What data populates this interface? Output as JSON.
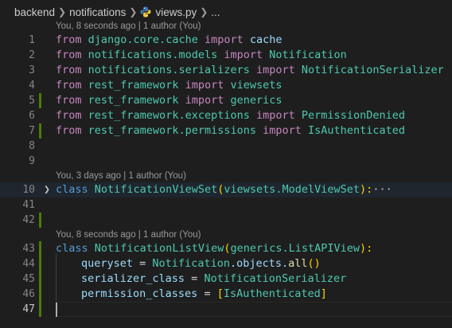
{
  "breadcrumb": {
    "items": [
      "backend",
      "notifications",
      "views.py",
      "..."
    ],
    "file_icon": "python-icon"
  },
  "codelens": {
    "header1": "You, 8 seconds ago | 1 author (You)",
    "header2": "You, 3 days ago | 1 author (You)",
    "header3": "You, 8 seconds ago | 1 author (You)"
  },
  "lines": {
    "l1": {
      "num": "1",
      "from": "from",
      "module": "django.core.cache",
      "import": "import",
      "name": "cache"
    },
    "l2": {
      "num": "2",
      "from": "from",
      "module": "notifications.models",
      "import": "import",
      "name": "Notification"
    },
    "l3": {
      "num": "3",
      "from": "from",
      "module": "notifications.serializers",
      "import": "import",
      "name": "NotificationSerializer"
    },
    "l4": {
      "num": "4",
      "from": "from",
      "module": "rest_framework",
      "import": "import",
      "name": "viewsets"
    },
    "l5": {
      "num": "5",
      "from": "from",
      "module": "rest_framework",
      "import": "import",
      "name": "generics"
    },
    "l6": {
      "num": "6",
      "from": "from",
      "module": "rest_framework.exceptions",
      "import": "import",
      "name": "PermissionDenied"
    },
    "l7": {
      "num": "7",
      "from": "from",
      "module": "rest_framework.permissions",
      "import": "import",
      "name": "IsAuthenticated"
    },
    "l8": {
      "num": "8"
    },
    "l9": {
      "num": "9"
    },
    "l10": {
      "num": "10",
      "kw": "class",
      "cls": "NotificationViewSet",
      "open": "(",
      "base": "viewsets.ModelViewSet",
      "close": "):",
      "ellipsis": "···"
    },
    "l41": {
      "num": "41"
    },
    "l42": {
      "num": "42"
    },
    "l43": {
      "num": "43",
      "kw": "class",
      "cls": "NotificationListView",
      "open": "(",
      "base": "generics.ListAPIView",
      "close": "):"
    },
    "l44": {
      "num": "44",
      "attr": "queryset",
      "eq": " = ",
      "cls": "Notification",
      "rest": ".objects.",
      "fn": "all",
      "call": "()"
    },
    "l45": {
      "num": "45",
      "attr": "serializer_class",
      "eq": " = ",
      "cls": "NotificationSerializer"
    },
    "l46": {
      "num": "46",
      "attr": "permission_classes",
      "eq": " = ",
      "open": "[",
      "cls": "IsAuthenticated",
      "close": "]"
    },
    "l47": {
      "num": "47"
    }
  },
  "colors": {
    "background": "#1e1e1e",
    "keyword_import": "#c586c0",
    "keyword": "#569cd6",
    "class": "#4ec9b0",
    "variable": "#9cdcfe",
    "function": "#dcdcaa",
    "git_added": "#487e02"
  }
}
